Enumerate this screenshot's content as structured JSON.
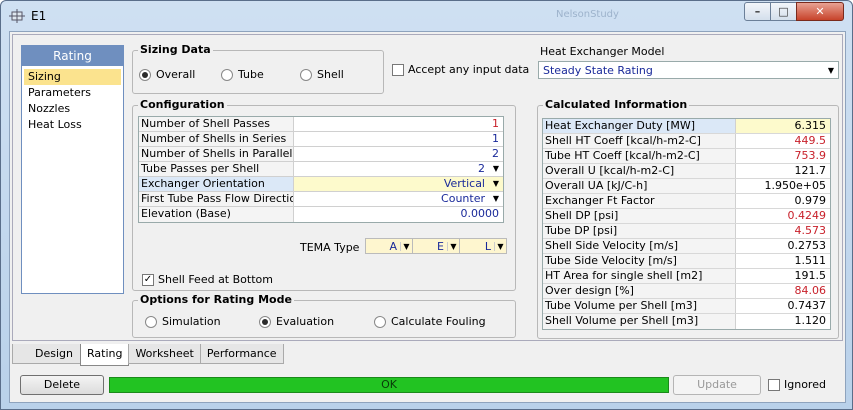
{
  "window": {
    "title": "E1",
    "title_ghost": "NelsonStudy"
  },
  "nav": {
    "header": "Rating",
    "items": [
      {
        "label": "Sizing",
        "active": true
      },
      {
        "label": "Parameters"
      },
      {
        "label": "Nozzles"
      },
      {
        "label": "Heat Loss"
      }
    ]
  },
  "sizing_data": {
    "title": "Sizing Data",
    "options": [
      "Overall",
      "Tube",
      "Shell"
    ],
    "selected": "Overall"
  },
  "accept_input": {
    "label": "Accept any input data",
    "checked": false
  },
  "model": {
    "label": "Heat Exchanger Model",
    "value": "Steady State Rating"
  },
  "configuration": {
    "title": "Configuration",
    "rows": [
      {
        "label": "Number of Shell Passes",
        "value": "1",
        "color": "red"
      },
      {
        "label": "Number of Shells in Series",
        "value": "1",
        "color": "blue"
      },
      {
        "label": "Number of Shells in Parallel",
        "value": "2",
        "color": "blue"
      },
      {
        "label": "Tube Passes per Shell",
        "value": "2",
        "color": "blue",
        "dropdown": true
      },
      {
        "label": "Exchanger Orientation",
        "value": "Vertical",
        "color": "blue",
        "dropdown": true,
        "selected": true
      },
      {
        "label": "First Tube Pass Flow Direction",
        "value": "Counter",
        "color": "blue",
        "dropdown": true
      },
      {
        "label": "Elevation (Base)",
        "value": "0.0000",
        "color": "blue"
      }
    ]
  },
  "tema": {
    "label": "TEMA Type",
    "values": [
      "A",
      "E",
      "L"
    ]
  },
  "shell_feed": {
    "label": "Shell Feed at Bottom",
    "checked": true
  },
  "rating_mode": {
    "title": "Options for Rating Mode",
    "options": [
      "Simulation",
      "Evaluation",
      "Calculate Fouling"
    ],
    "selected": "Evaluation"
  },
  "calculated": {
    "title": "Calculated Information",
    "rows": [
      {
        "label": "Heat Exchanger Duty [MW]",
        "value": "6.315"
      },
      {
        "label": "Shell HT Coeff [kcal/h-m2-C]",
        "value": "449.5",
        "red": true
      },
      {
        "label": "Tube HT Coeff [kcal/h-m2-C]",
        "value": "753.9",
        "red": true
      },
      {
        "label": "Overall U [kcal/h-m2-C]",
        "value": "121.7"
      },
      {
        "label": "Overall UA [kJ/C-h]",
        "value": "1.950e+05"
      },
      {
        "label": "Exchanger Ft Factor",
        "value": "0.979"
      },
      {
        "label": "Shell DP [psi]",
        "value": "0.4249",
        "red": true
      },
      {
        "label": "Tube DP [psi]",
        "value": "4.573",
        "red": true
      },
      {
        "label": "Shell Side Velocity [m/s]",
        "value": "0.2753"
      },
      {
        "label": "Tube Side Velocity [m/s]",
        "value": "1.511"
      },
      {
        "label": "HT Area for single shell [m2]",
        "value": "191.5"
      },
      {
        "label": "Over design [%]",
        "value": "84.06",
        "red": true
      },
      {
        "label": "Tube Volume per Shell [m3]",
        "value": "0.7437"
      },
      {
        "label": "Shell Volume per Shell [m3]",
        "value": "1.120"
      }
    ]
  },
  "tabs": [
    {
      "label": "Design"
    },
    {
      "label": "Rating",
      "active": true
    },
    {
      "label": "Worksheet"
    },
    {
      "label": "Performance"
    }
  ],
  "bottom": {
    "delete_label": "Delete",
    "status": "OK",
    "status_color": "#22c322",
    "update_label": "Update",
    "ignored_label": "Ignored"
  }
}
